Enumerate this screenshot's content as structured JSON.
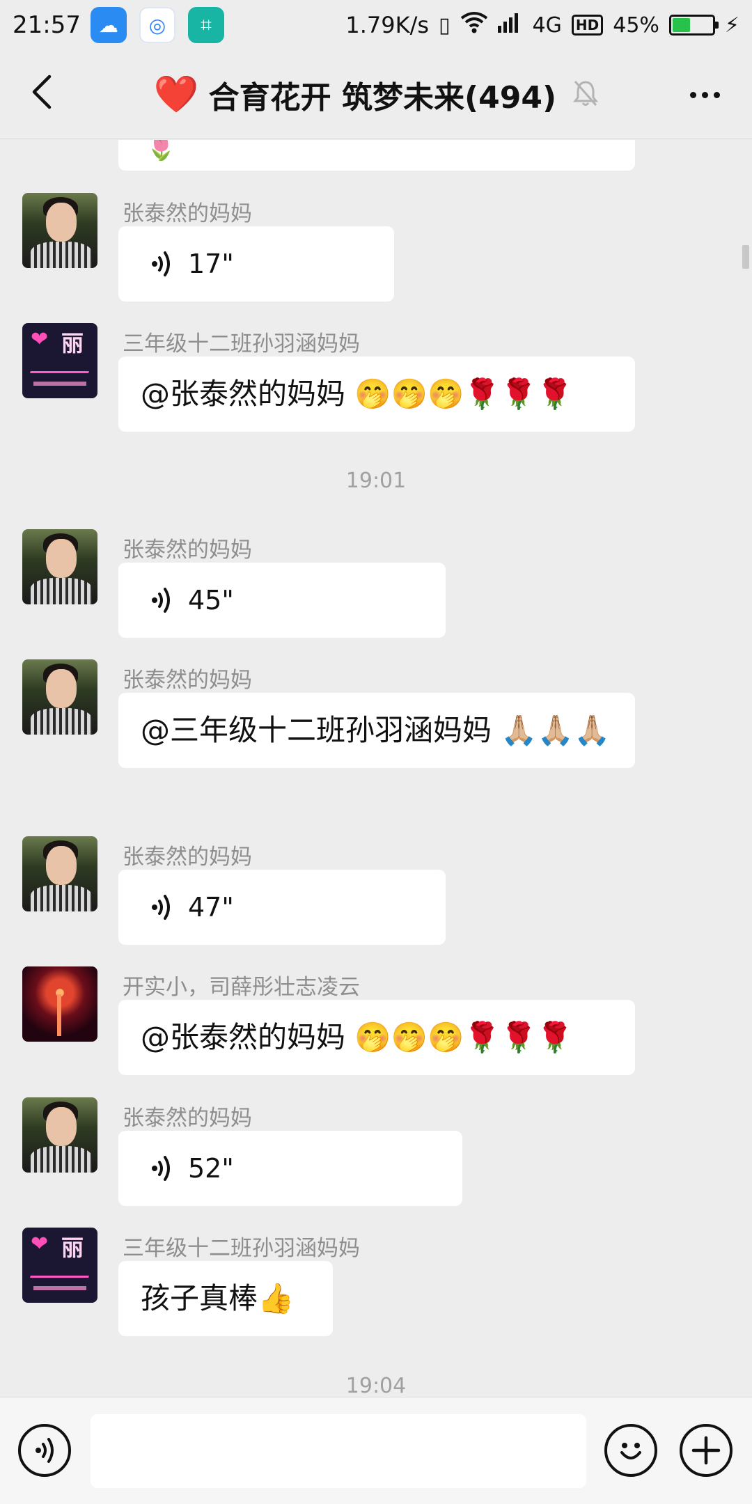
{
  "status_bar": {
    "time": "21:57",
    "net_speed": "1.79K/s",
    "network": "4G",
    "hd": "HD",
    "battery": "45%",
    "battery_level": 0.45
  },
  "header": {
    "title": "合育花开 筑梦未来(494)",
    "title_emoji": "❤️"
  },
  "messages": [
    {
      "sender": "张泰然的妈妈",
      "type": "voice",
      "duration": "17\""
    },
    {
      "sender": "三年级十二班孙羽涵妈妈",
      "type": "text",
      "text": "@张泰然的妈妈 🤭🤭🤭🌹🌹🌹"
    },
    {
      "timestamp": "19:01"
    },
    {
      "sender": "张泰然的妈妈",
      "type": "voice",
      "duration": "45\""
    },
    {
      "sender": "张泰然的妈妈",
      "type": "text",
      "text": "@三年级十二班孙羽涵妈妈 🙏🏼🙏🏼🙏🏼"
    },
    {
      "sender": "张泰然的妈妈",
      "type": "voice",
      "duration": "47\""
    },
    {
      "sender": "开实小，司薛彤壮志凌云",
      "type": "text",
      "text": "@张泰然的妈妈 🤭🤭🤭🌹🌹🌹"
    },
    {
      "sender": "张泰然的妈妈",
      "type": "voice",
      "duration": "52\""
    },
    {
      "sender": "三年级十二班孙羽涵妈妈",
      "type": "text",
      "text": "孩子真棒👍"
    },
    {
      "timestamp": "19:04"
    }
  ],
  "partial_top_emoji": "🌷",
  "avatar_labels": {
    "neon_heart": "❤",
    "neon_char": "丽"
  },
  "colors": {
    "background": "#ededed",
    "bubble": "#ffffff",
    "accent_heart": "#e0152c",
    "battery_green": "#27c24c"
  },
  "icons": [
    "back-icon",
    "mute-bell-icon",
    "more-icon",
    "voice-wave-icon",
    "emoji-icon",
    "plus-icon"
  ]
}
